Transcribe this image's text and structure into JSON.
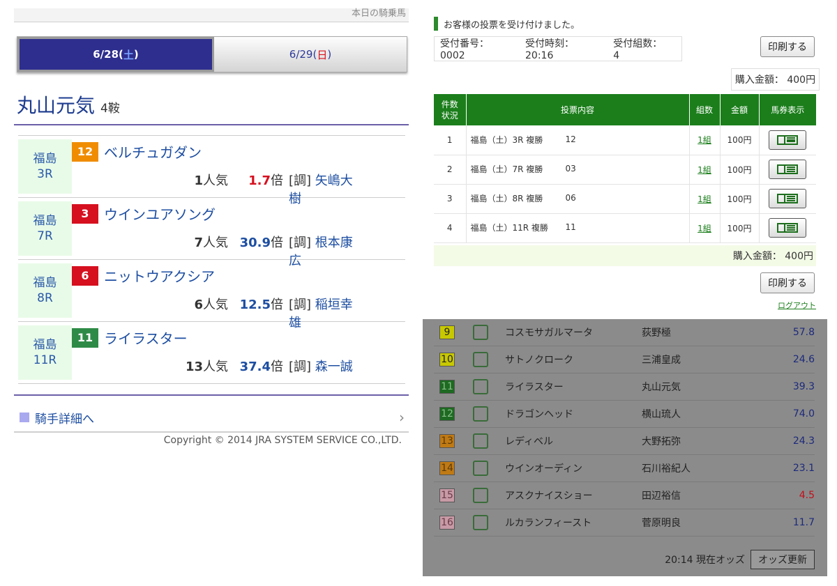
{
  "left": {
    "top_link": "本日の騎乗馬",
    "tabs": [
      {
        "date": "6/28(",
        "dow": "土",
        "close": ")"
      },
      {
        "date": "6/29(",
        "dow": "日",
        "close": ")"
      }
    ],
    "jockey": {
      "name": "丸山元気",
      "count": "4鞍"
    },
    "rides": [
      {
        "venue": "福島",
        "race": "3R",
        "num": "12",
        "num_color": "#f08c00",
        "horse": "ベルチュガダン",
        "pop": "1",
        "pop_unit": "人気",
        "odds": "1.7",
        "odds_unit": "倍",
        "trainer_tag": "[調]",
        "trainer": "矢嶋大樹",
        "fav": true
      },
      {
        "venue": "福島",
        "race": "7R",
        "num": "3",
        "num_color": "#d6101f",
        "horse": "ウインユアソング",
        "pop": "7",
        "pop_unit": "人気",
        "odds": "30.9",
        "odds_unit": "倍",
        "trainer_tag": "[調]",
        "trainer": "根本康広",
        "fav": false
      },
      {
        "venue": "福島",
        "race": "8R",
        "num": "6",
        "num_color": "#d6101f",
        "horse": "ニットウアクシア",
        "pop": "6",
        "pop_unit": "人気",
        "odds": "12.5",
        "odds_unit": "倍",
        "trainer_tag": "[調]",
        "trainer": "稲垣幸雄",
        "fav": false
      },
      {
        "venue": "福島",
        "race": "11R",
        "num": "11",
        "num_color": "#2e8b47",
        "horse": "ライラスター",
        "pop": "13",
        "pop_unit": "人気",
        "odds": "37.4",
        "odds_unit": "倍",
        "trainer_tag": "[調]",
        "trainer": "森一誠",
        "fav": false
      }
    ],
    "jockey_detail": "騎手詳細へ",
    "copyright": "Copyright © 2014 JRA SYSTEM SERVICE CO.,LTD."
  },
  "right": {
    "message": "お客様の投票を受け付けました。",
    "receipt_no": "受付番号： 0002",
    "receipt_time": "受付時刻： 20:16",
    "receipt_sets": "受付組数： 4",
    "print_label": "印刷する",
    "total": "購入金額： 400円",
    "table_headers": [
      "件数\n状況",
      "投票内容",
      "組数",
      "金額",
      "馬券表示"
    ],
    "bets": [
      {
        "no": "1",
        "content": "福島（土）3R 複勝",
        "sel": "12",
        "sets": "1組",
        "amount": "100円"
      },
      {
        "no": "2",
        "content": "福島（土）7R 複勝",
        "sel": "03",
        "sets": "1組",
        "amount": "100円"
      },
      {
        "no": "3",
        "content": "福島（土）8R 複勝",
        "sel": "06",
        "sets": "1組",
        "amount": "100円"
      },
      {
        "no": "4",
        "content": "福島（土）11R 複勝",
        "sel": "11",
        "sets": "1組",
        "amount": "100円"
      }
    ],
    "logout": "ログアウト",
    "odds_rows": [
      {
        "num": "9",
        "num_bg": "#c8c800",
        "num_fg": "#222",
        "horse": "コスモサガルマータ",
        "jockey": "荻野極",
        "odds": "57.8",
        "fav": false
      },
      {
        "num": "10",
        "num_bg": "#c8c800",
        "num_fg": "#222",
        "horse": "サトノクローク",
        "jockey": "三浦皇成",
        "odds": "24.6",
        "fav": false
      },
      {
        "num": "11",
        "num_bg": "#1e6a22",
        "num_fg": "#8bbf8b",
        "horse": "ライラスター",
        "jockey": "丸山元気",
        "odds": "39.3",
        "fav": false
      },
      {
        "num": "12",
        "num_bg": "#1e6a22",
        "num_fg": "#8bbf8b",
        "horse": "ドラゴンヘッド",
        "jockey": "横山琉人",
        "odds": "74.0",
        "fav": false
      },
      {
        "num": "13",
        "num_bg": "#c07a14",
        "num_fg": "#5a3a0a",
        "horse": "レディベル",
        "jockey": "大野拓弥",
        "odds": "24.3",
        "fav": false
      },
      {
        "num": "14",
        "num_bg": "#c07a14",
        "num_fg": "#5a3a0a",
        "horse": "ウインオーディン",
        "jockey": "石川裕紀人",
        "odds": "23.1",
        "fav": false
      },
      {
        "num": "15",
        "num_bg": "#c79aa6",
        "num_fg": "#6a3a48",
        "horse": "アスクナイスショー",
        "jockey": "田辺裕信",
        "odds": "4.5",
        "fav": true
      },
      {
        "num": "16",
        "num_bg": "#c79aa6",
        "num_fg": "#6a3a48",
        "horse": "ルカランフィースト",
        "jockey": "菅原明良",
        "odds": "11.7",
        "fav": false
      }
    ],
    "odds_time": "20:14 現在オッズ",
    "refresh_label": "オッズ更新"
  }
}
